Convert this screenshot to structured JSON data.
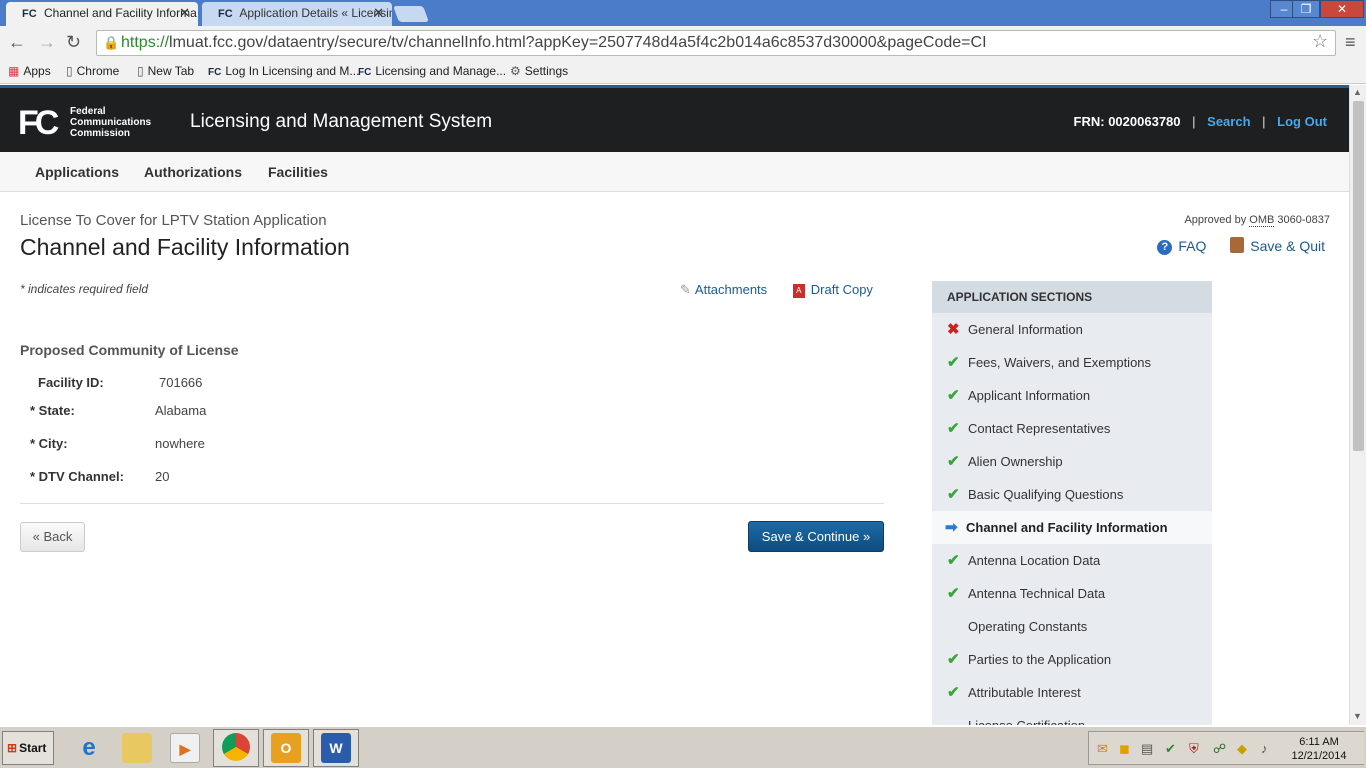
{
  "browser": {
    "tabs": [
      {
        "favicon": "FC",
        "title": "Channel and Facility Informa"
      },
      {
        "favicon": "FC",
        "title": "Application Details « Licensin"
      }
    ],
    "url_scheme": "https://",
    "url_rest": "lmuat.fcc.gov/dataentry/secure/tv/channelInfo.html?appKey=2507748d4a5f4c2b014a6c8537d30000&pageCode=CI",
    "window_buttons": [
      "–",
      "❐",
      "✕"
    ],
    "bookmarks": [
      {
        "icon": "apps-icon",
        "glyph": "▦",
        "label": "Apps"
      },
      {
        "icon": "page-icon",
        "glyph": "▯",
        "label": "Chrome"
      },
      {
        "icon": "page-icon",
        "glyph": "▯",
        "label": "New Tab"
      },
      {
        "icon": "fcc-favicon",
        "glyph": "FC",
        "label": "Log In Licensing and M..."
      },
      {
        "icon": "fcc-favicon",
        "glyph": "FC",
        "label": "Licensing and Manage..."
      },
      {
        "icon": "gear-icon",
        "glyph": "⚙",
        "label": "Settings"
      }
    ]
  },
  "header": {
    "logo": "FC",
    "agency_line1": "Federal",
    "agency_line2": "Communications",
    "agency_line3": "Commission",
    "system_title": "Licensing and Management System",
    "frn": "FRN: 0020063780",
    "search": "Search",
    "logout": "Log Out",
    "separator": "|"
  },
  "topnav": [
    "Applications",
    "Authorizations",
    "Facilities"
  ],
  "page": {
    "app_type": "License To Cover for LPTV Station Application",
    "title": "Channel and Facility Information",
    "omb_prefix": "Approved by ",
    "omb_abbr": "OMB",
    "omb_number": " 3060-0837",
    "faq": "FAQ",
    "save_quit": "Save & Quit",
    "required_note": "* indicates required field",
    "attachments": "Attachments",
    "draft_copy": "Draft Copy",
    "section_heading": "Proposed Community of License",
    "fields": [
      {
        "label": "Facility ID:",
        "value": "701666"
      },
      {
        "label": "* State:",
        "value": "Alabama"
      },
      {
        "label": "* City:",
        "value": "nowhere"
      },
      {
        "label": "* DTV Channel:",
        "value": "20"
      }
    ],
    "back_button": "« Back",
    "save_continue_button": "Save & Continue »"
  },
  "sidebar": {
    "heading": "APPLICATION SECTIONS",
    "items": [
      {
        "label": "General Information",
        "status": "error",
        "mark": "✖"
      },
      {
        "label": "Fees, Waivers, and Exemptions",
        "status": "complete",
        "mark": "✔"
      },
      {
        "label": "Applicant Information",
        "status": "complete",
        "mark": "✔"
      },
      {
        "label": "Contact Representatives",
        "status": "complete",
        "mark": "✔"
      },
      {
        "label": "Alien Ownership",
        "status": "complete",
        "mark": "✔"
      },
      {
        "label": "Basic Qualifying Questions",
        "status": "complete",
        "mark": "✔"
      },
      {
        "label": "Channel and Facility Information",
        "status": "current",
        "mark": "➡"
      },
      {
        "label": "Antenna Location Data",
        "status": "complete",
        "mark": "✔"
      },
      {
        "label": "Antenna Technical Data",
        "status": "complete",
        "mark": "✔"
      },
      {
        "label": "Operating Constants",
        "status": "none",
        "mark": ""
      },
      {
        "label": "Parties to the Application",
        "status": "complete",
        "mark": "✔"
      },
      {
        "label": "Attributable Interest",
        "status": "complete",
        "mark": "✔"
      },
      {
        "label": "License Certification",
        "status": "none",
        "mark": ""
      }
    ]
  },
  "taskbar": {
    "start_label": "Start",
    "clock_time": "6:11 AM",
    "clock_date": "12/21/2014"
  },
  "colors": {
    "header_bg": "#1e1f21",
    "link_blue": "#1a5a9a",
    "header_link": "#4aa8e8",
    "primary_button": "#0e4d80",
    "check_green": "#3aa53a",
    "error_red": "#cc2222"
  }
}
